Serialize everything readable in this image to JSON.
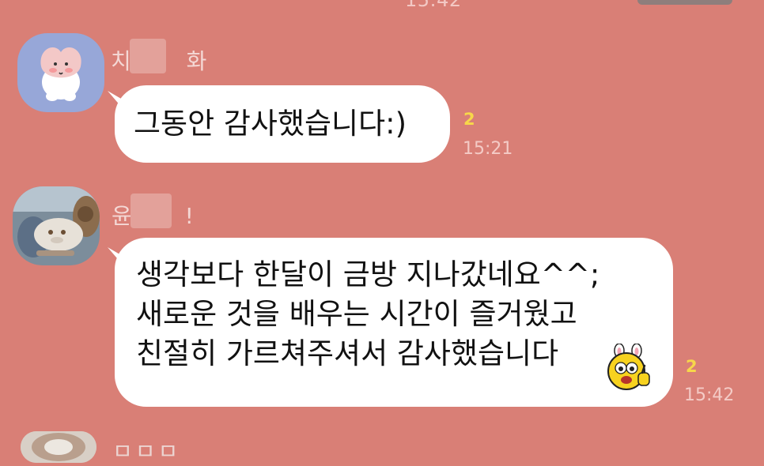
{
  "top": {
    "time": "15:42"
  },
  "messages": [
    {
      "sender": "치 화",
      "sender_first": "치",
      "sender_last": "화",
      "text": "그동안 감사했습니다:)",
      "unread": "2",
      "time": "15:21",
      "avatar_icon": "peach-character-icon"
    },
    {
      "sender": "윤 !",
      "sender_first": "윤",
      "sender_last": "!",
      "text_lines": [
        "생각보다 한달이  금방  지나갔네요^^;",
        "새로운 것을 배우는 시간이 즐거웠고",
        "친절히 가르쳐주셔서 감사했습니다"
      ],
      "unread": "2",
      "time": "15:42",
      "avatar_icon": "cafe-photo-icon",
      "emoticon_icon": "bunny-thumbs-up-emoticon"
    }
  ],
  "next": {
    "sender_partial": "ㅁㅁㅁ"
  },
  "colors": {
    "background": "#d97f76",
    "bubble": "#ffffff",
    "unread": "#f7d74a",
    "time": "#f4cbc6"
  }
}
